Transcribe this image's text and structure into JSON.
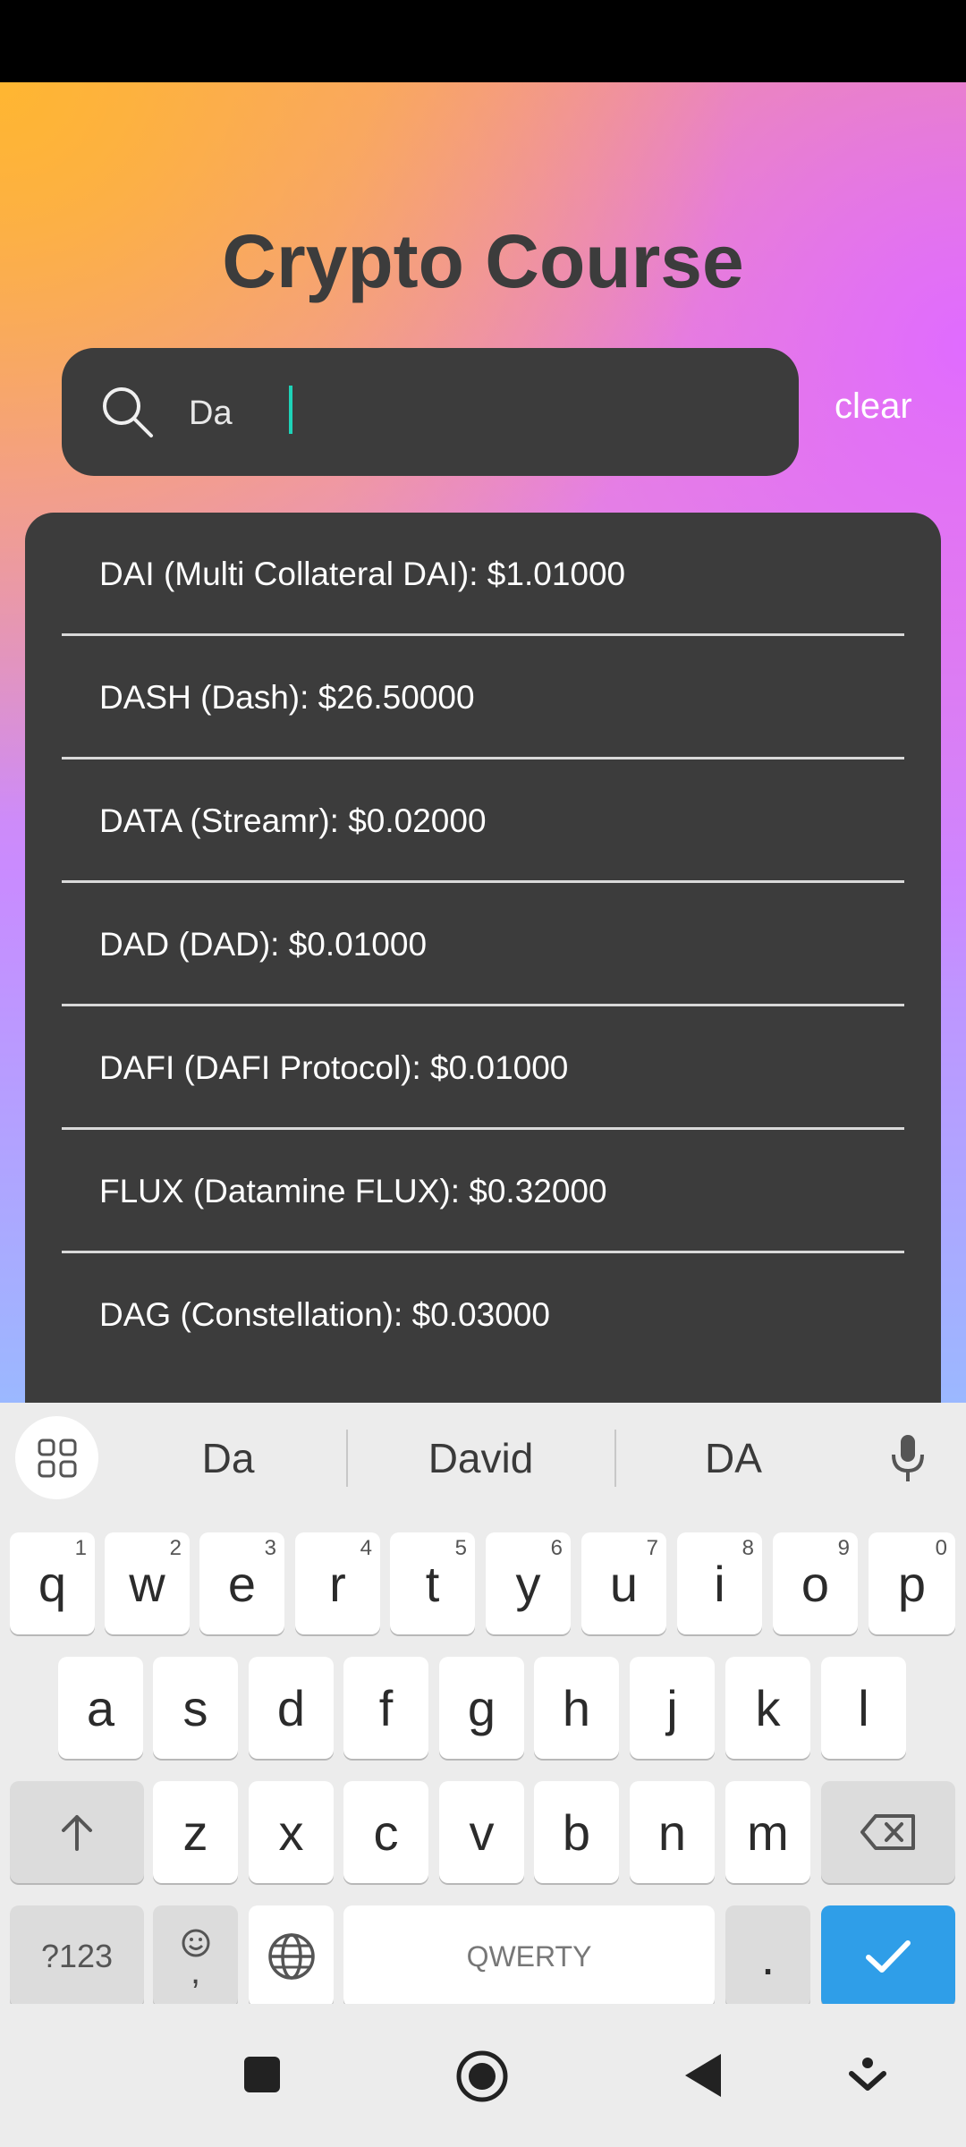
{
  "app": {
    "title": "Crypto Course"
  },
  "search": {
    "value": "Da",
    "clear_label": "clear"
  },
  "results": [
    "DAI (Multi Collateral DAI): $1.01000",
    "DASH (Dash): $26.50000",
    "DATA (Streamr): $0.02000",
    "DAD (DAD): $0.01000",
    "DAFI (DAFI Protocol): $0.01000",
    "FLUX (Datamine FLUX): $0.32000",
    "DAG (Constellation): $0.03000"
  ],
  "keyboard": {
    "suggestions": [
      "Da",
      "David",
      "DA"
    ],
    "row1": [
      {
        "key": "q",
        "hint": "1"
      },
      {
        "key": "w",
        "hint": "2"
      },
      {
        "key": "e",
        "hint": "3"
      },
      {
        "key": "r",
        "hint": "4"
      },
      {
        "key": "t",
        "hint": "5"
      },
      {
        "key": "y",
        "hint": "6"
      },
      {
        "key": "u",
        "hint": "7"
      },
      {
        "key": "i",
        "hint": "8"
      },
      {
        "key": "o",
        "hint": "9"
      },
      {
        "key": "p",
        "hint": "0"
      }
    ],
    "row2": [
      "a",
      "s",
      "d",
      "f",
      "g",
      "h",
      "j",
      "k",
      "l"
    ],
    "row3": [
      "z",
      "x",
      "c",
      "v",
      "b",
      "n",
      "m"
    ],
    "symbols_label": "?123",
    "comma_label": ",",
    "space_label": "QWERTY",
    "period_label": "."
  },
  "icons": {
    "search": "search-icon",
    "grid": "grid-icon",
    "mic": "mic-icon",
    "shift": "shift-icon",
    "backspace": "backspace-icon",
    "emoji": "emoji-icon",
    "globe": "globe-icon",
    "done": "check-icon"
  },
  "colors": {
    "accent": "#2f9ee8",
    "cursor": "#1ed3b8",
    "panel": "#3c3c3c"
  }
}
